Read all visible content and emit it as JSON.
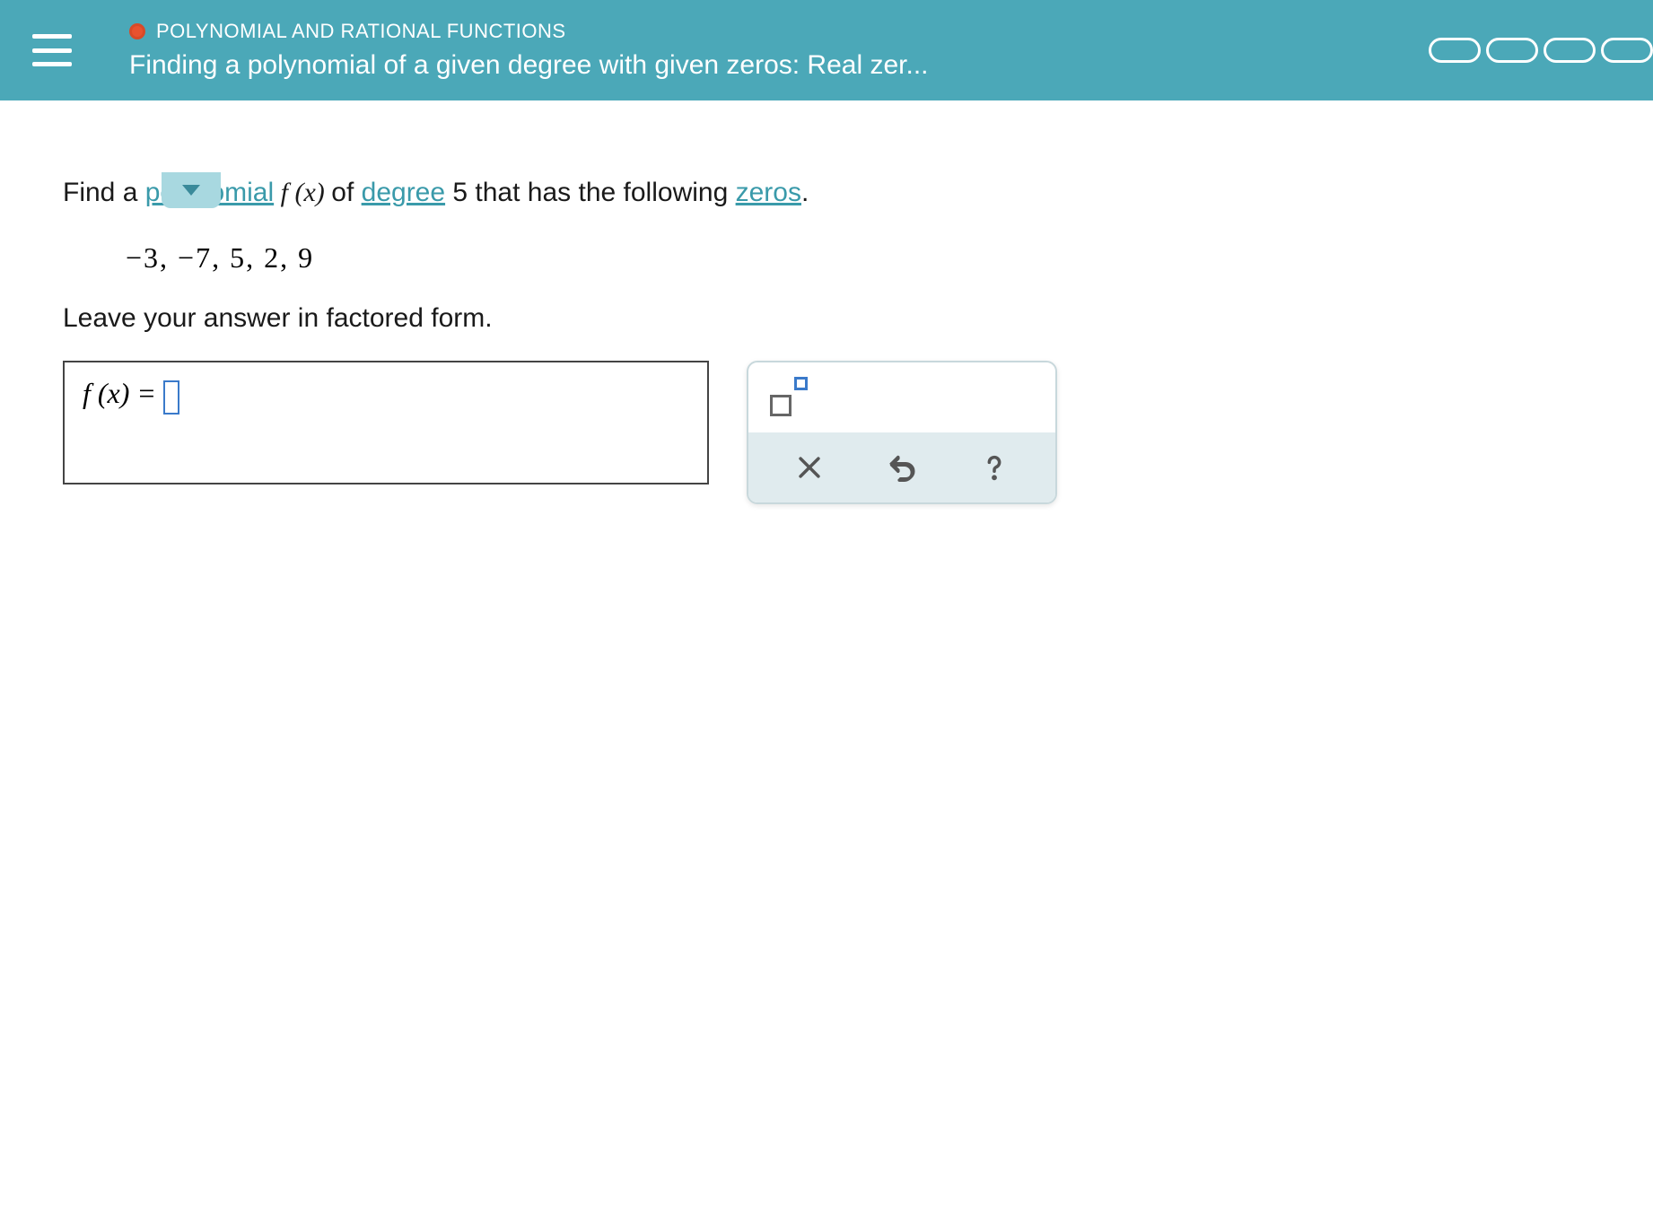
{
  "header": {
    "category": "POLYNOMIAL AND RATIONAL FUNCTIONS",
    "title": "Finding a polynomial of a given degree with given zeros: Real zer..."
  },
  "question": {
    "prefix": "Find a ",
    "term_polynomial": "polynomial",
    "fx": " f (x) ",
    "of": "of ",
    "term_degree": "degree",
    "degree_value": " 5 that has the following ",
    "term_zeros": "zeros",
    "suffix": "."
  },
  "zeros_list": "−3,  −7,  5,  2,  9",
  "instruction": "Leave your answer in factored form.",
  "answer": {
    "lhs": "f (x) = "
  },
  "icons": {
    "menu": "menu-icon",
    "dropdown": "chevron-down-icon",
    "exponent": "exponent-tool-icon",
    "clear": "x-icon",
    "undo": "undo-icon",
    "help": "help-icon"
  }
}
